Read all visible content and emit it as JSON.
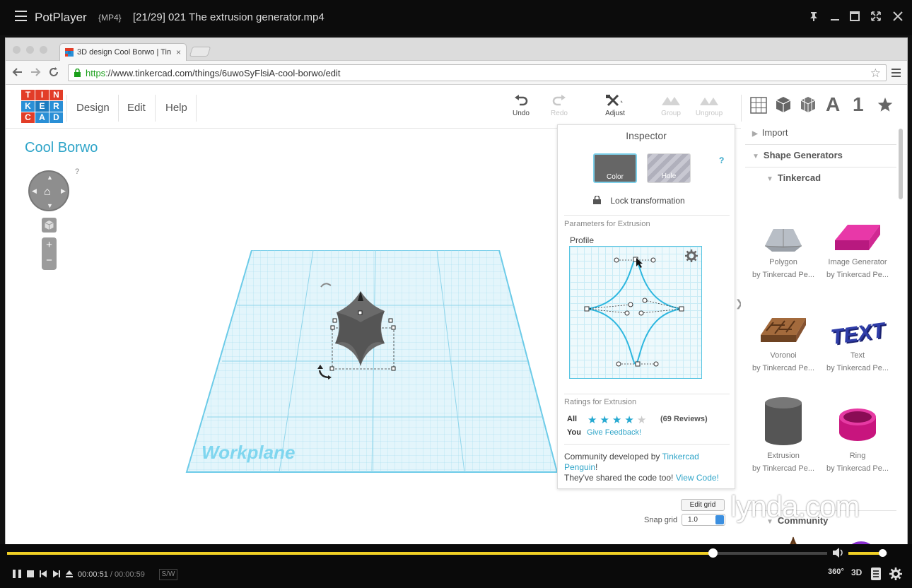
{
  "player": {
    "app_name": "PotPlayer",
    "format": "{MP4}",
    "file": "[21/29] 021 The extrusion generator.mp4",
    "time_current": "00:00:51",
    "time_total": "/ 00:00:59",
    "sw_label": "S/W",
    "badge_360": "360°",
    "badge_3d": "3D",
    "progress": 0.86,
    "volume": 0.88,
    "colors": {
      "accent": "#f0cf25"
    }
  },
  "browser": {
    "tab_title": "3D design Cool Borwo | Tin",
    "tab_close": "×",
    "url_scheme": "https",
    "url_rest": "://www.tinkercad.com/things/6uwoSyFlsiA-cool-borwo/edit"
  },
  "tinkercad": {
    "logo_letters": [
      "T",
      "I",
      "N",
      "K",
      "E",
      "R",
      "C",
      "A",
      "D"
    ],
    "logo_colors": [
      "#e23d28",
      "#e23d28",
      "#e23d28",
      "#2a8fd6",
      "#1d7cc0",
      "#2a8fd6",
      "#e23d28",
      "#2a8fd6",
      "#2a8fd6"
    ],
    "menu": [
      "Design",
      "Edit",
      "Help"
    ],
    "tools": {
      "undo": "Undo",
      "redo": "Redo",
      "adjust": "Adjust",
      "group": "Group",
      "ungroup": "Ungroup"
    },
    "right_icons": [
      "grid-icon",
      "cube-icon",
      "shapes-icon",
      "letter-a-icon",
      "number-1-icon",
      "star-icon"
    ],
    "right_icon_text": {
      "letter": "A",
      "number": "1"
    },
    "project_name": "Cool Borwo",
    "help_mark": "?",
    "workplane_label": "Workplane",
    "edit_grid": "Edit grid",
    "snap_label": "Snap grid",
    "snap_value": "1.0"
  },
  "inspector": {
    "title": "Inspector",
    "color_label": "Color",
    "hole_label": "Hole",
    "help": "?",
    "lock_label": "Lock transformation",
    "params_title": "Parameters for Extrusion",
    "profile_label": "Profile",
    "ratings_title": "Ratings for Extrusion",
    "all_label": "All",
    "rating": 4,
    "rating_max": 5,
    "reviews": "(69 Reviews)",
    "you_label": "You",
    "feedback_link": "Give Feedback!",
    "community_prefix": "Community developed by ",
    "community_author_1": "Tinkercad",
    "community_author_2": "Penguin",
    "community_bang": "!",
    "shared_text": "They've shared the code too! ",
    "view_code": "View Code!"
  },
  "panel": {
    "import": "Import",
    "shape_generators": "Shape Generators",
    "tinkercad": "Tinkercad",
    "community": "Community",
    "shapes": [
      {
        "name": "Polygon",
        "author": "by Tinkercad Pe..."
      },
      {
        "name": "Image Generator",
        "author": "by Tinkercad Pe..."
      },
      {
        "name": "Voronoi",
        "author": "by Tinkercad Pe..."
      },
      {
        "name": "Text",
        "author": "by Tinkercad Pe..."
      },
      {
        "name": "Extrusion",
        "author": "by Tinkercad Pe..."
      },
      {
        "name": "Ring",
        "author": "by Tinkercad Pe..."
      }
    ],
    "text_thumb": "TEXT"
  },
  "watermark": "lynda.com"
}
